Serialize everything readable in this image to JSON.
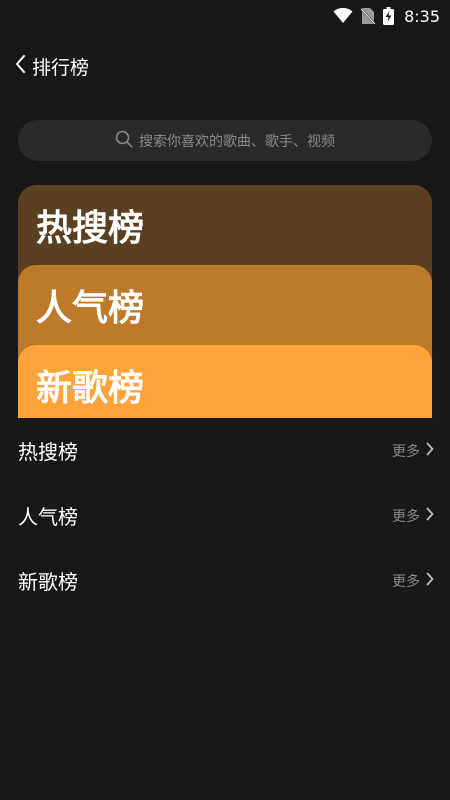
{
  "status_bar": {
    "time": "8:35"
  },
  "header": {
    "title": "排行榜"
  },
  "search": {
    "placeholder": "搜索你喜欢的歌曲、歌手、视频"
  },
  "cards": [
    {
      "label": "热搜榜",
      "color": "#5a3f20"
    },
    {
      "label": "人气榜",
      "color": "#bd7a2a"
    },
    {
      "label": "新歌榜",
      "color": "#ffa33a"
    }
  ],
  "list": [
    {
      "label": "热搜榜",
      "more": "更多"
    },
    {
      "label": "人气榜",
      "more": "更多"
    },
    {
      "label": "新歌榜",
      "more": "更多"
    }
  ],
  "colors": {
    "background": "#181818",
    "search_bg": "#2a2a2a",
    "muted_text": "#8a8a8a"
  }
}
